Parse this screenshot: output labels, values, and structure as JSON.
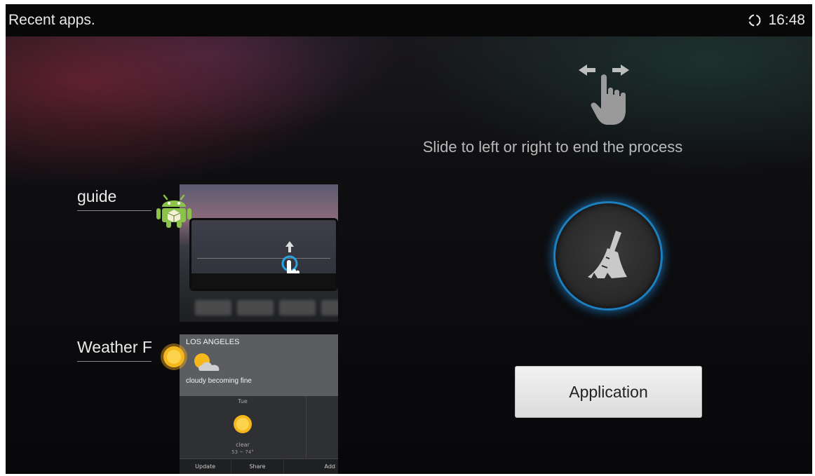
{
  "status_bar": {
    "title": "Recent apps.",
    "time": "16:48",
    "icons": [
      "sync-icon"
    ]
  },
  "hint": {
    "text": "Slide to left or right to end the process",
    "icon": "swipe-hand-icon"
  },
  "clear_button": {
    "icon": "broom-icon"
  },
  "application_button": {
    "label": "Application"
  },
  "recent_apps": [
    {
      "label": "guide",
      "icon": "android-icon"
    },
    {
      "label": "Weather F",
      "icon": "sun-icon",
      "thumbnail": {
        "city": "LOS ANGELES",
        "condition": "cloudy becoming fine",
        "day": "Tue",
        "day_condition": "clear",
        "temp": "53 ~ 74°",
        "actions": [
          "Update",
          "Share",
          "Add"
        ]
      }
    }
  ],
  "colors": {
    "accent_glow": "#1d7fbf",
    "status_bar_bg": "#080808"
  }
}
